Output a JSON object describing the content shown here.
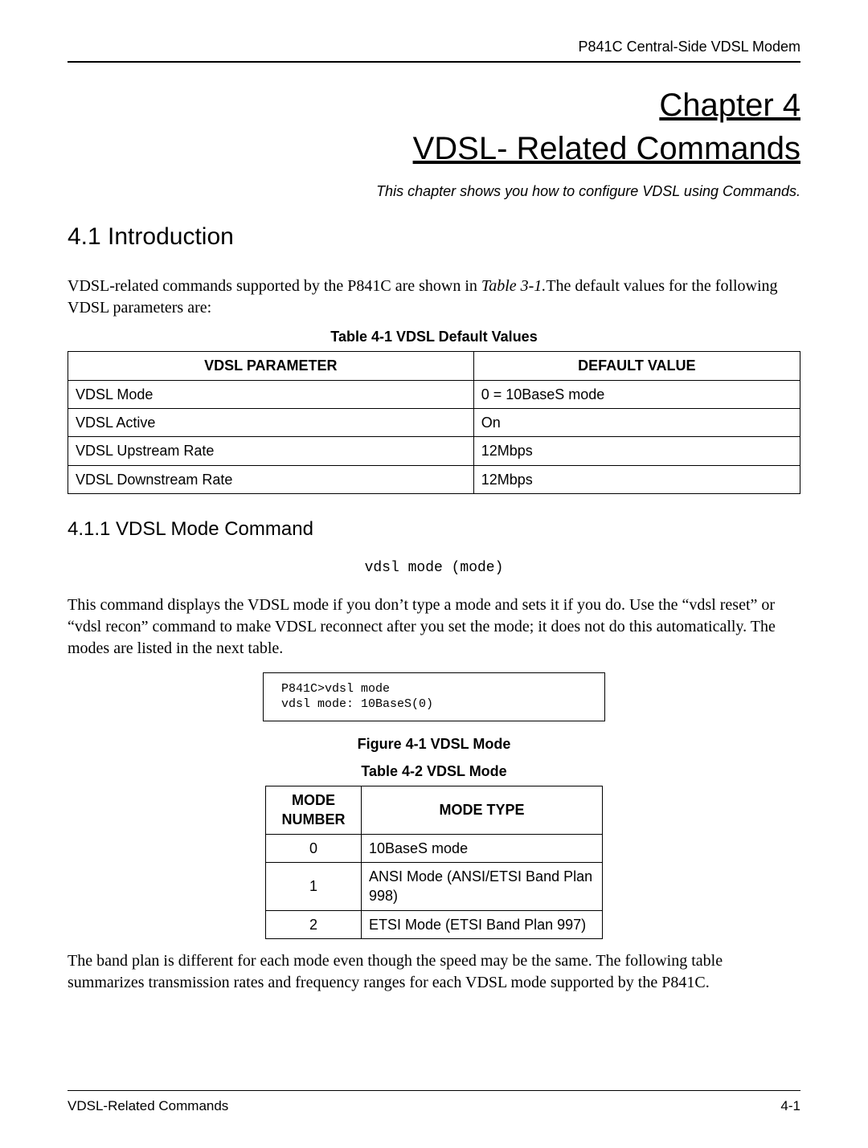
{
  "header": {
    "doc_title": "P841C Central-Side VDSL Modem"
  },
  "chapter": {
    "line1": "Chapter 4",
    "line2": "VDSL- Related Commands",
    "subtitle": "This chapter shows you how to configure VDSL using Commands."
  },
  "section_intro": {
    "heading": "4.1  Introduction",
    "para_before_ref": "VDSL-related commands supported by the P841C are shown in ",
    "ref_text": "Table 3-1.",
    "para_after_ref": "The default values for the following VDSL parameters are:"
  },
  "table1": {
    "caption": "Table 4-1 VDSL Default Values",
    "headers": {
      "col1": "VDSL PARAMETER",
      "col2": "DEFAULT VALUE"
    },
    "rows": [
      {
        "param": "VDSL Mode",
        "value": "0 = 10BaseS mode"
      },
      {
        "param": "VDSL Active",
        "value": "On"
      },
      {
        "param": "VDSL Upstream Rate",
        "value": "12Mbps"
      },
      {
        "param": "VDSL Downstream Rate",
        "value": "12Mbps"
      }
    ]
  },
  "section_mode": {
    "heading": "4.1.1   VDSL Mode Command",
    "syntax": "vdsl mode (mode)",
    "desc": "This command displays the VDSL mode if you don’t type a mode and sets it if you do. Use the “vdsl reset” or “vdsl recon” command to make VDSL reconnect after you set the mode; it does not do this automatically. The modes are listed in the next table.",
    "terminal": "P841C>vdsl mode\nvdsl mode: 10BaseS(0)",
    "figure_caption": "Figure 4-1 VDSL Mode"
  },
  "table2": {
    "caption": "Table 4-2 VDSL Mode",
    "headers": {
      "col1": "MODE NUMBER",
      "col2": "MODE TYPE"
    },
    "rows": [
      {
        "num": "0",
        "type": "10BaseS mode"
      },
      {
        "num": "1",
        "type": "ANSI Mode (ANSI/ETSI Band Plan 998)"
      },
      {
        "num": "2",
        "type": "ETSI Mode (ETSI Band Plan 997)"
      }
    ]
  },
  "closing": {
    "para": "The band plan is different for each mode even though the speed may be the same. The following table summarizes transmission rates and frequency ranges for each VDSL mode supported by the P841C."
  },
  "footer": {
    "left": "VDSL-Related Commands",
    "right": "4-1"
  }
}
